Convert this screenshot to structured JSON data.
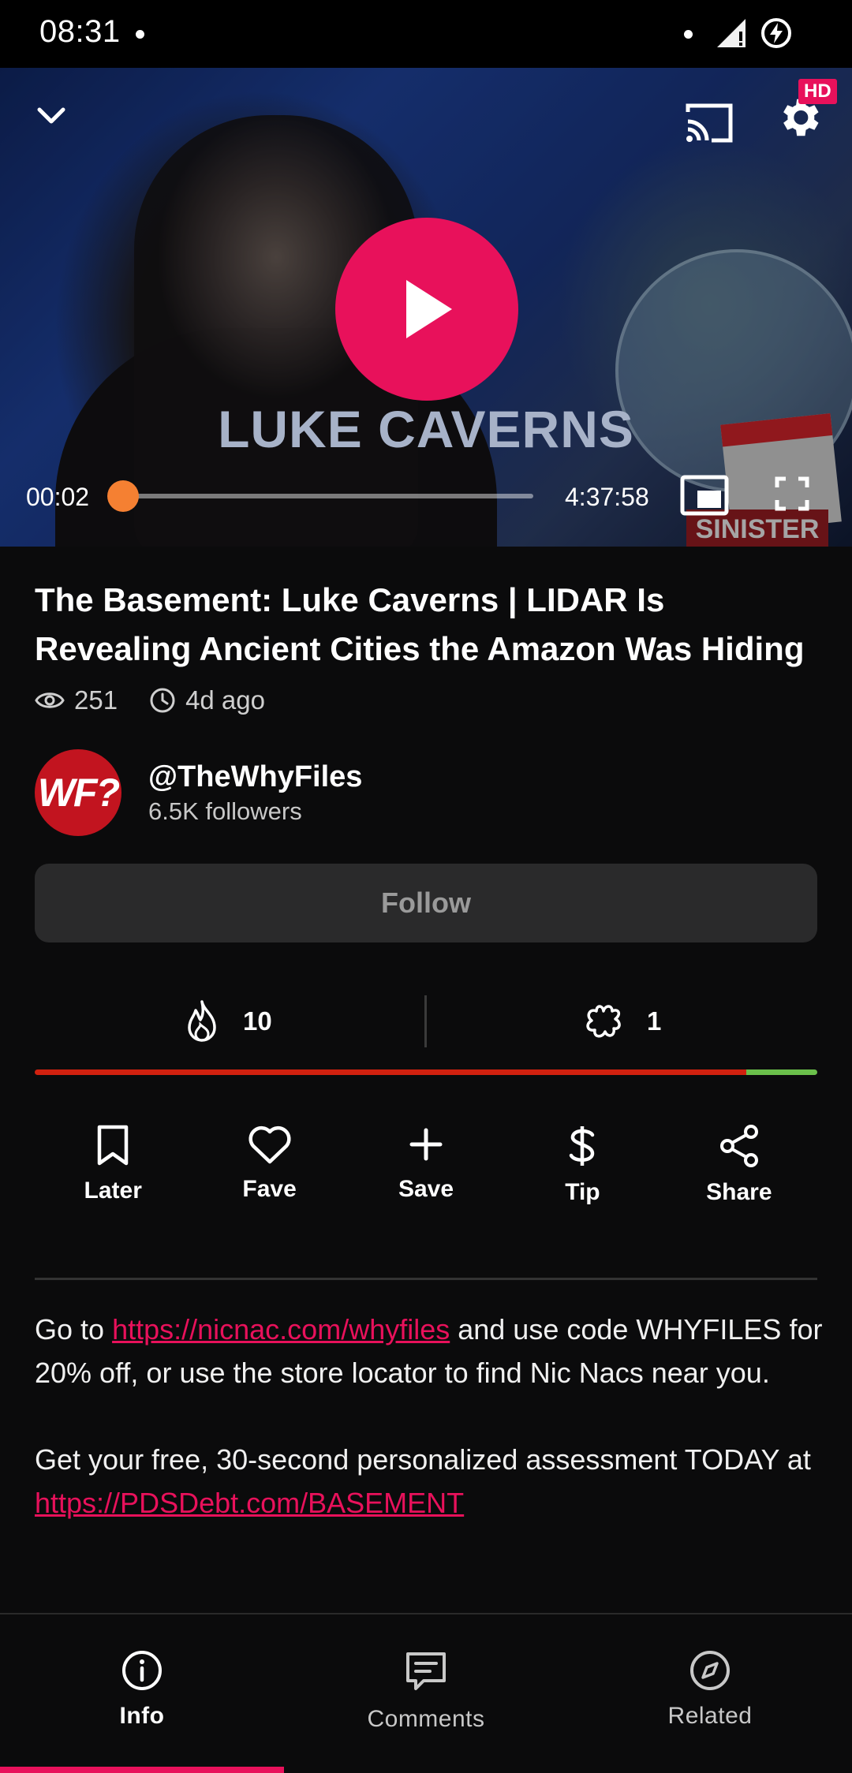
{
  "status_bar": {
    "time": "08:31"
  },
  "player": {
    "overlay_name": "LUKE CAVERNS",
    "quality_badge": "HD",
    "current_time": "00:02",
    "total_time": "4:37:58",
    "progress": 0.0001,
    "colors": {
      "accent": "#e8115b",
      "seek_knob": "#f58032"
    }
  },
  "video": {
    "title": "The Basement: Luke Caverns | LIDAR Is Revealing Ancient Cities the Amazon Was Hiding",
    "views": "251",
    "posted": "4d ago"
  },
  "channel": {
    "avatar_text": "WF?",
    "handle": "@TheWhyFiles",
    "followers": "6.5K followers",
    "follow_label": "Follow"
  },
  "reactions": {
    "likes": "10",
    "dislikes": "1",
    "like_ratio": 0.909,
    "colors": {
      "likes": "#d1210f",
      "dislikes": "#6bc04b"
    }
  },
  "actions": [
    {
      "icon": "bookmark-icon",
      "label": "Later"
    },
    {
      "icon": "heart-icon",
      "label": "Fave"
    },
    {
      "icon": "plus-icon",
      "label": "Save"
    },
    {
      "icon": "dollar-icon",
      "label": "Tip"
    },
    {
      "icon": "share-icon",
      "label": "Share"
    }
  ],
  "description": {
    "p1_prefix": "Go to ",
    "p1_link": "https://nicnac.com/whyfiles",
    "p1_suffix": " and use code WHYFILES for 20% off, or use the store  locator to find Nic Nacs near you.",
    "p2_prefix": "Get your free, 30-second personalized assessment TODAY at ",
    "p2_link": "https://PDSDebt.com/BASEMENT"
  },
  "bottom_nav": {
    "tabs": [
      {
        "icon": "info-icon",
        "label": "Info",
        "active": true
      },
      {
        "icon": "comments-icon",
        "label": "Comments",
        "active": false
      },
      {
        "icon": "compass-icon",
        "label": "Related",
        "active": false
      }
    ]
  }
}
